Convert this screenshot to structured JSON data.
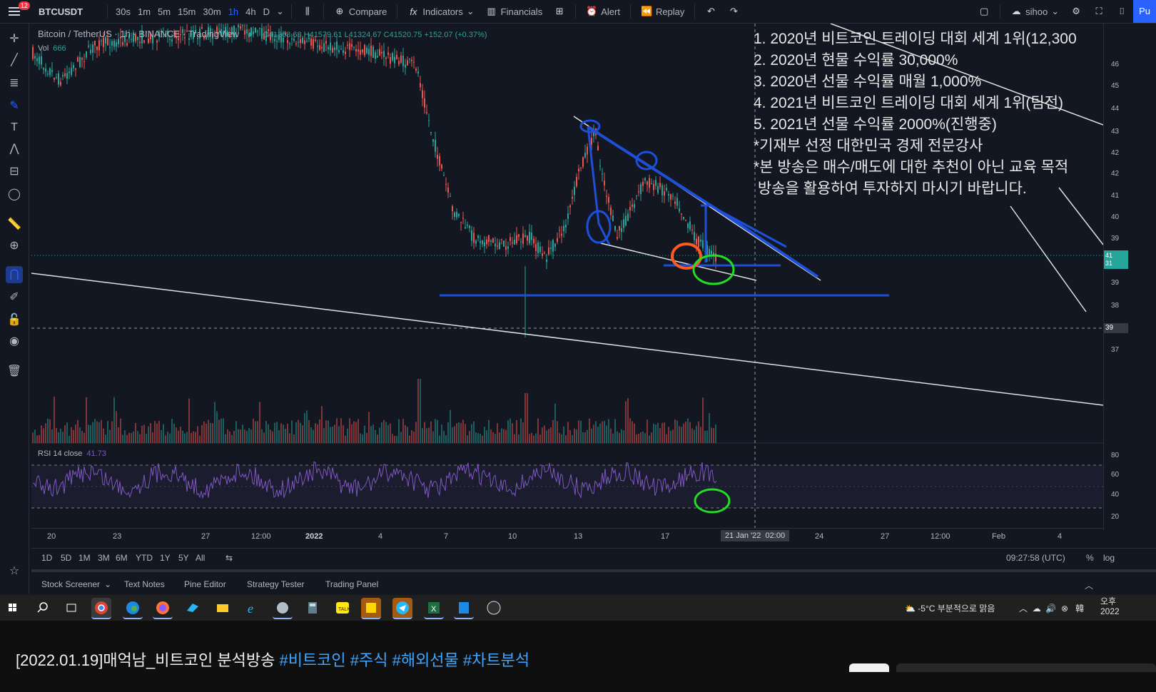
{
  "toolbar": {
    "notification_count": "12",
    "symbol": "BTCUSDT",
    "timeframes": [
      "30s",
      "1m",
      "5m",
      "15m",
      "30m",
      "1h",
      "4h",
      "D"
    ],
    "active_timeframe": "1h",
    "compare_label": "Compare",
    "indicators_label": "Indicators",
    "financials_label": "Financials",
    "alert_label": "Alert",
    "replay_label": "Replay",
    "layout_name": "sihoo",
    "publish_label": "Pu"
  },
  "legend": {
    "title": "Bitcoin / TetherUS · 1h · BINANCE · TradingView",
    "ohlc": "O41368.68 H41579.61 L41324.67 C41520.75 +152.07 (+0.37%)",
    "vol_label": "Vol",
    "vol_value": "666"
  },
  "rsi": {
    "label": "RSI 14 close",
    "value": "41.73",
    "levels": [
      "80",
      "60",
      "40",
      "20"
    ]
  },
  "overlay_notes": [
    "1. 2020년 비트코인 트레이딩 대회 세계 1위(12,300",
    "2. 2020년 현물 수익률 30,000%",
    "3. 2020년 선물 수익률 매월 1,000%",
    "4. 2021년 비트코인 트레이딩 대회 세계 1위(팀전)",
    "5. 2021년 선물 수익률 2000%(진행중)",
    "*기재부 선정 대한민국 경제 전문강사",
    "*본 방송은 매수/매도에 대한 추천이 아닌 교육 목적",
    " 방송을 활용하여 투자하지 마시기 바랍니다."
  ],
  "price_axis": {
    "labels": [
      "46",
      "45",
      "44",
      "43",
      "42",
      "42",
      "41",
      "40",
      "39",
      "39",
      "38",
      "38",
      "37"
    ],
    "current_price_tag": "41\n31",
    "crosshair_tag": "39"
  },
  "time_axis": {
    "labels": [
      "20",
      "23",
      "27",
      "12:00",
      "2022",
      "4",
      "7",
      "10",
      "13",
      "17",
      "24",
      "27",
      "12:00",
      "Feb",
      "4"
    ],
    "crosshair_date": "21 Jan '22",
    "crosshair_time": "02:00"
  },
  "range_bar": {
    "ranges": [
      "1D",
      "5D",
      "1M",
      "3M",
      "6M",
      "YTD",
      "1Y",
      "5Y",
      "All"
    ],
    "clock": "09:27:58 (UTC)",
    "percent_label": "%",
    "log_label": "log"
  },
  "bottom_tabs": [
    "Stock Screener",
    "Text Notes",
    "Pine Editor",
    "Strategy Tester",
    "Trading Panel"
  ],
  "taskbar": {
    "weather": "-5°C 부분적으로 맑음",
    "time_line1": "오후",
    "time_line2": "2022"
  },
  "video_caption": {
    "title": "[2022.01.19]매억남_비트코인 분석방송",
    "hashtags": [
      "#비트코인",
      "#주식",
      "#해외선물",
      "#차트분석"
    ]
  },
  "colors": {
    "bg": "#131722",
    "accent": "#2962ff",
    "up": "#26a69a",
    "down": "#ef5350",
    "rsi": "#7e57c2",
    "drawing_blue": "#1e4fd8",
    "drawing_orange": "#ff5a1f",
    "drawing_green": "#22dd22"
  }
}
